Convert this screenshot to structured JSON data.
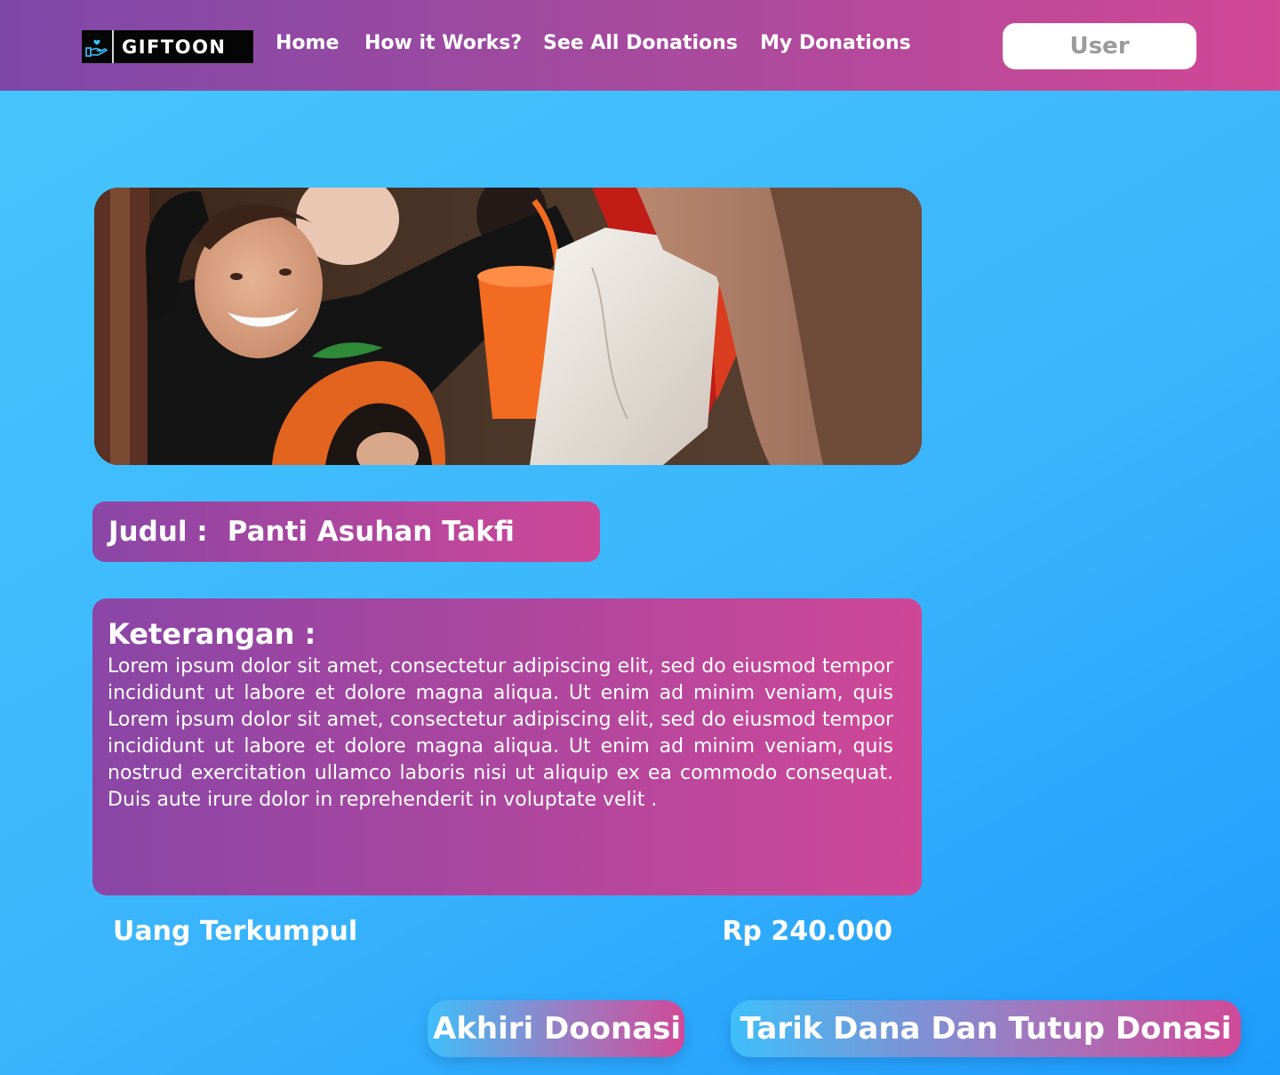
{
  "header": {
    "logo_text": "GIFTOON",
    "nav": {
      "home": "Home",
      "how_it_works": "How it Works?",
      "see_all_donations": "See All Donations",
      "my_donations": "My Donations"
    },
    "user_button": "User"
  },
  "donation": {
    "title_label": "Judul :",
    "title_value": "Panti Asuhan Takfi",
    "description_heading": "Keterangan :",
    "description_text": "Lorem ipsum dolor sit amet, consectetur adipiscing elit, sed do eiusmod tempor incididunt ut labore et dolore magna aliqua. Ut enim ad minim veniam, quis Lorem ipsum dolor sit amet, consectetur adipiscing elit, sed do eiusmod tempor incididunt ut labore et dolore magna aliqua. Ut enim ad minim veniam, quis nostrud exercitation ullamco laboris nisi ut aliquip ex ea commodo consequat. Duis aute irure dolor in reprehenderit in voluptate velit .",
    "collected_label": "Uang Terkumpul",
    "collected_amount": "Rp 240.000"
  },
  "actions": {
    "end_donation": "Akhiri Doonasi",
    "withdraw_and_close": "Tarik Dana Dan Tutup Donasi"
  },
  "colors": {
    "header_start": "#7e48a8",
    "header_end": "#d14895",
    "background": "#3bb6fd",
    "card_start": "#8a46a6",
    "card_end": "#cf4797"
  },
  "icons": {
    "logo": "hand-heart-icon"
  }
}
